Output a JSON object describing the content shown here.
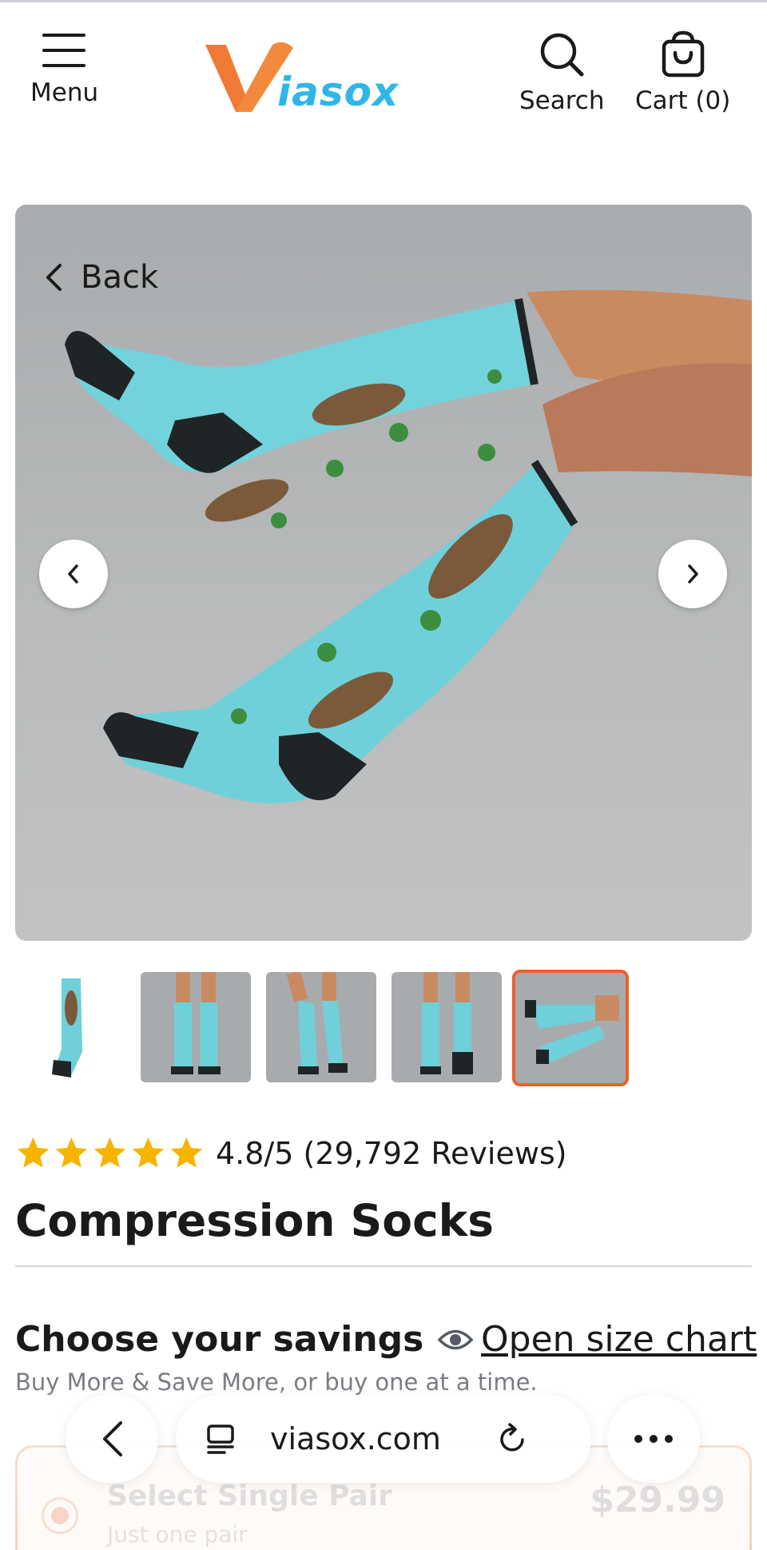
{
  "header": {
    "menu_label": "Menu",
    "logo_text": "iasox",
    "search_label": "Search",
    "cart_label": "Cart (0)"
  },
  "gallery": {
    "back_label": "Back",
    "thumbnail_count": 5,
    "active_thumbnail_index": 4
  },
  "product": {
    "stars": 5,
    "rating_text": "4.8/5 (29,792 Reviews)",
    "title": "Compression Socks"
  },
  "savings": {
    "title": "Choose your savings",
    "size_chart_label": "Open size chart",
    "subtitle": "Buy More & Save More, or buy one at a time."
  },
  "option": {
    "title": "Select Single Pair",
    "subtitle": "Just one pair",
    "price": "$29.99"
  },
  "browser": {
    "url": "viasox.com"
  },
  "colors": {
    "brand_orange": "#ef7a35",
    "brand_blue": "#2fb6e8",
    "sock_teal": "#6fd3df",
    "star_yellow": "#f6b400",
    "active_border": "#e8612d"
  }
}
